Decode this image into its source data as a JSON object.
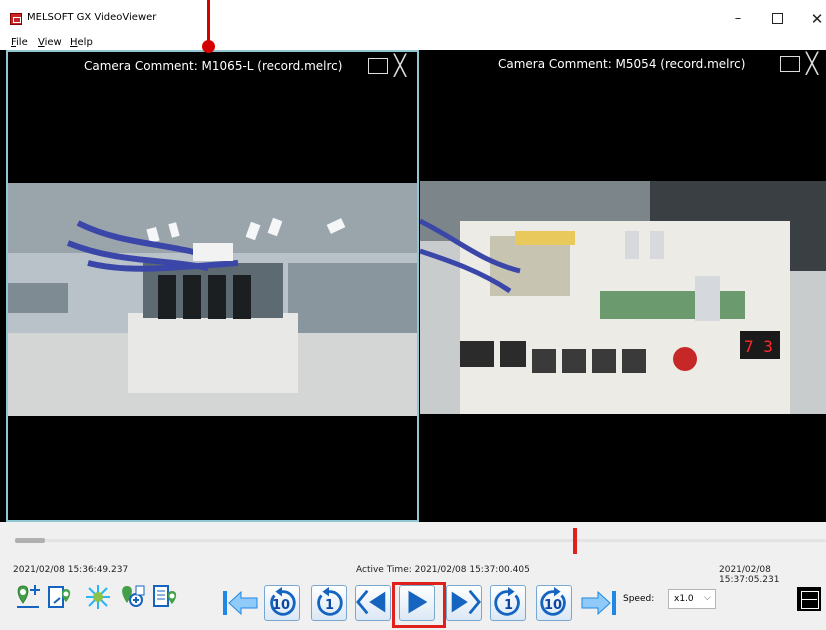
{
  "window": {
    "title": "MELSOFT GX VideoViewer",
    "minimize": "–",
    "close": "✕"
  },
  "menu": {
    "items": [
      "File",
      "View",
      "Help"
    ]
  },
  "cameras": [
    {
      "comment": "Camera Comment: M1065-L (record.melrc)",
      "selected": true
    },
    {
      "comment": "Camera Comment: M5054 (record.melrc)",
      "selected": false
    }
  ],
  "timeline": {
    "start_time": "2021/02/08  15:36:49.237",
    "active_time": "Active Time: 2021/02/08  15:37:00.405",
    "end_time": "2021/02/08  15:37:05.231",
    "position_fraction": 0.69
  },
  "playback": {
    "buttons": [
      "jump-to-start",
      "back-10",
      "back-1",
      "previous-frame",
      "play",
      "next-frame",
      "forward-1",
      "forward-10",
      "jump-to-end"
    ],
    "back10_label": "10",
    "back1_label": "1",
    "fwd1_label": "1",
    "fwd10_label": "10"
  },
  "speed": {
    "label": "Speed:",
    "value": "x1.0",
    "arrow": "⌵"
  },
  "colors": {
    "accent_red": "#e0201a",
    "selected_border": "#8fc7d3",
    "icon_blue": "#1565c0",
    "icon_green": "#43a047"
  }
}
